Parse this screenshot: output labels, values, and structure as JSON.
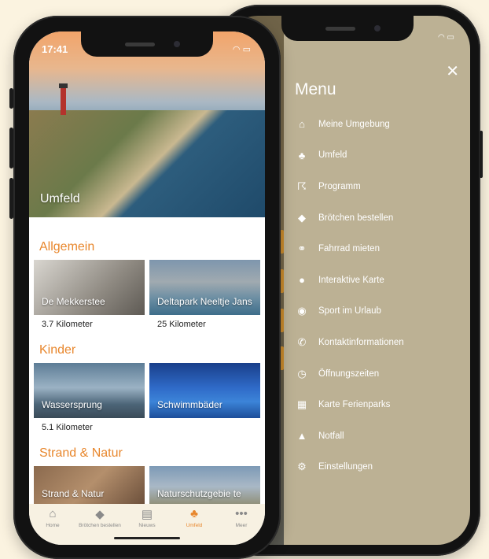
{
  "front": {
    "status_time": "17:41",
    "hero_title": "Umfeld",
    "sections": [
      {
        "title": "Allgemein",
        "cards": [
          {
            "label": "De Mekkerstee",
            "distance": "3.7 Kilometer"
          },
          {
            "label": "Deltapark Neeltje Jans",
            "distance": "25 Kilometer"
          }
        ]
      },
      {
        "title": "Kinder",
        "cards": [
          {
            "label": "Wassersprung",
            "distance": "5.1 Kilometer"
          },
          {
            "label": "Schwimmbäder",
            "distance": ""
          }
        ]
      },
      {
        "title": "Strand & Natur",
        "cards": [
          {
            "label": "Strand & Natur",
            "distance": ""
          },
          {
            "label": "Naturschutzgebie te",
            "distance": ""
          }
        ]
      }
    ],
    "tabs": [
      {
        "label": "Home",
        "icon": "home-icon"
      },
      {
        "label": "Brötchen bestellen",
        "icon": "bread-icon"
      },
      {
        "label": "Nieuws",
        "icon": "news-icon"
      },
      {
        "label": "Umfeld",
        "icon": "area-icon",
        "active": true
      },
      {
        "label": "Meer",
        "icon": "more-icon"
      }
    ]
  },
  "menu": {
    "title": "Menu",
    "close_glyph": "✕",
    "items": [
      {
        "label": "Meine Umgebung",
        "icon": "house-icon"
      },
      {
        "label": "Umfeld",
        "icon": "area-icon"
      },
      {
        "label": "Programm",
        "icon": "person-icon"
      },
      {
        "label": "Brötchen bestellen",
        "icon": "bread-icon"
      },
      {
        "label": "Fahrrad mieten",
        "icon": "bike-icon"
      },
      {
        "label": "Interaktive Karte",
        "icon": "pin-icon"
      },
      {
        "label": "Sport im Urlaub",
        "icon": "ball-icon"
      },
      {
        "label": "Kontaktinformationen",
        "icon": "phone-icon"
      },
      {
        "label": "Öffnungszeiten",
        "icon": "clock-icon"
      },
      {
        "label": "Karte Ferienparks",
        "icon": "map-icon"
      },
      {
        "label": "Notfall",
        "icon": "warning-icon"
      },
      {
        "label": "Einstellungen",
        "icon": "settings-icon"
      }
    ]
  },
  "colors": {
    "accent": "#e8872d",
    "menu_bg": "#bcb194",
    "page_bg": "#fbf3e0"
  }
}
